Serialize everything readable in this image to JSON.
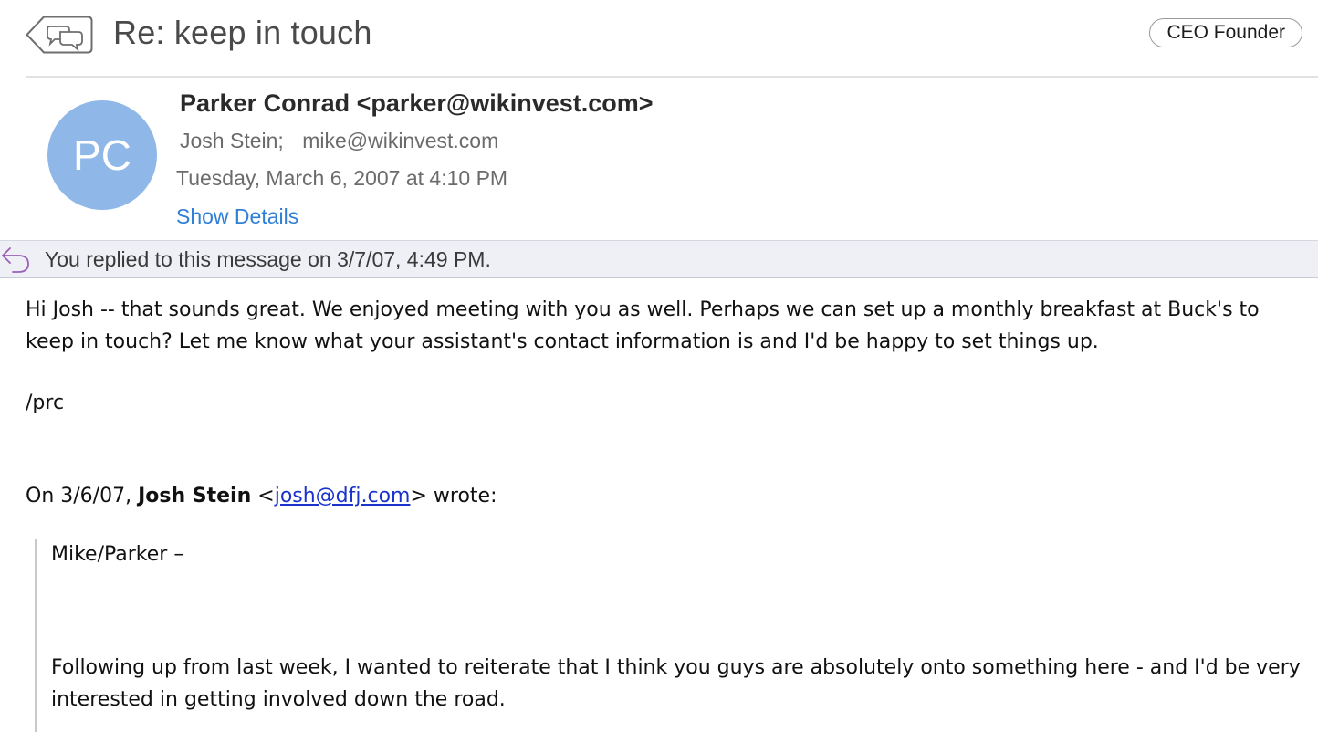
{
  "header": {
    "subject": "Re: keep in touch",
    "tag": "CEO Founder",
    "conversation_icon": "conversation-back-icon"
  },
  "sender": {
    "avatar_initials": "PC",
    "avatar_color": "#8fb8e8",
    "from": "Parker Conrad <parker@wikinvest.com>",
    "recipient_1": "Josh Stein;",
    "recipient_2": "mike@wikinvest.com",
    "datetime": "Tuesday, March 6, 2007 at 4:10 PM",
    "show_details_label": "Show Details"
  },
  "replied_banner": {
    "icon": "reply-arrow-icon",
    "text": "You replied to this message on 3/7/07, 4:49 PM."
  },
  "body": {
    "paragraph_1": "Hi Josh -- that sounds great. We enjoyed meeting with you as well. Perhaps we can set up a monthly breakfast at Buck's to keep in touch? Let me know what your assistant's contact information is and I'd be happy to set things up.",
    "signature": "/prc",
    "attribution_prefix": "On 3/6/07, ",
    "attribution_name": "Josh Stein",
    "attribution_open": " <",
    "attribution_email": "josh@dfj.com",
    "attribution_suffix": "> wrote:",
    "quoted_greeting": "Mike/Parker –",
    "quoted_paragraph": "Following up from last week, I wanted to reiterate that I think you guys are absolutely onto something here - and I'd be very interested in getting involved down the road."
  },
  "colors": {
    "link_blue": "#2f7fd6",
    "email_link": "#1a33cc",
    "banner_bg": "#eef0f6",
    "reply_icon": "#9b5db5"
  }
}
